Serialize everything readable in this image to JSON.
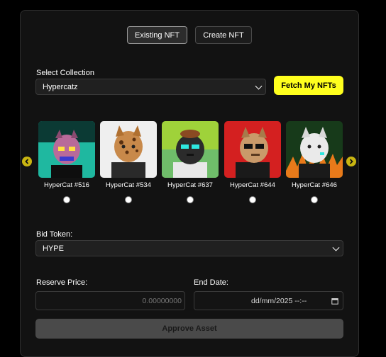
{
  "toggle": {
    "existing_label": "Existing NFT",
    "create_label": "Create NFT"
  },
  "collection": {
    "label": "Select Collection",
    "selected": "Hypercatz",
    "fetch_label": "Fetch My NFTs"
  },
  "nfts": [
    {
      "name": "HyperCat #516",
      "bg": "#1fb8a0"
    },
    {
      "name": "HyperCat #534",
      "bg": "#efefef"
    },
    {
      "name": "HyperCat #637",
      "bg": "#9fd23a"
    },
    {
      "name": "HyperCat #644",
      "bg": "#d42020"
    },
    {
      "name": "HyperCat #646",
      "bg": "#173a1a"
    }
  ],
  "bid_token": {
    "label": "Bid Token:",
    "selected": "HYPE"
  },
  "reserve": {
    "label": "Reserve Price:",
    "placeholder": "0.00000000"
  },
  "end_date": {
    "label": "End Date:",
    "value": "dd/mm/2025 --:--"
  },
  "approve_label": "Approve Asset",
  "colors": {
    "accent": "#ffff1e",
    "arrow": "#c9b511",
    "panel": "#121212"
  }
}
